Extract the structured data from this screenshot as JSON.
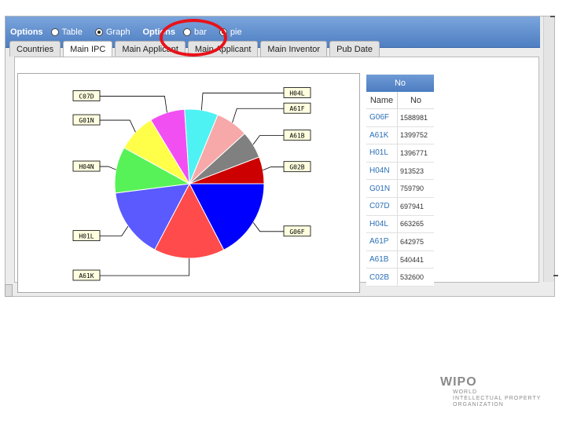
{
  "topbar": {
    "options1_label": "Options",
    "radio_table": "Table",
    "radio_graph": "Graph",
    "options2_label": "Options",
    "radio_bar": "bar",
    "radio_pie": "pie",
    "selected_view": "Graph",
    "selected_chart": "pie"
  },
  "tabs": [
    "Countries",
    "Main IPC",
    "Main Applicant",
    "Main Applicant",
    "Main Inventor",
    "Pub Date"
  ],
  "active_tab": "Main IPC",
  "table": {
    "title": "No",
    "col_name": "Name",
    "col_no": "No",
    "rows": [
      {
        "name": "G06F",
        "no": "1588981"
      },
      {
        "name": "A61K",
        "no": "1399752"
      },
      {
        "name": "H01L",
        "no": "1396771"
      },
      {
        "name": "H04N",
        "no": "913523"
      },
      {
        "name": "G01N",
        "no": "759790"
      },
      {
        "name": "C07D",
        "no": "697941"
      },
      {
        "name": "H04L",
        "no": "663265"
      },
      {
        "name": "A61P",
        "no": "642975"
      },
      {
        "name": "A61B",
        "no": "540441"
      },
      {
        "name": "C02B",
        "no": "532600"
      }
    ]
  },
  "chart_data": {
    "type": "pie",
    "slices": [
      {
        "label": "G06F",
        "value": 1588981,
        "color": "#0000ff"
      },
      {
        "label": "A61K",
        "value": 1399752,
        "color": "#ff4b4b"
      },
      {
        "label": "H01L",
        "value": 1396771,
        "color": "#5a5aff"
      },
      {
        "label": "H04N",
        "value": 913523,
        "color": "#57f257"
      },
      {
        "label": "G01N",
        "value": 759790,
        "color": "#ffff4a"
      },
      {
        "label": "C07D",
        "value": 697941,
        "color": "#f24ff2"
      },
      {
        "label": "H04L",
        "value": 663265,
        "color": "#4ff2f2"
      },
      {
        "label": "A61F",
        "value": 642975,
        "color": "#f7a8a8"
      },
      {
        "label": "A61B",
        "value": 540441,
        "color": "#808080"
      },
      {
        "label": "G02B",
        "value": 532600,
        "color": "#cc0000"
      }
    ]
  },
  "logo": {
    "main": "WIPO",
    "line1": "WORLD",
    "line2": "INTELLECTUAL PROPERTY",
    "line3": "ORGANIZATION"
  },
  "colors": {
    "header_blue": "#4f7fc2",
    "link_blue": "#2a6fb5",
    "highlight_red": "#e8121a"
  }
}
